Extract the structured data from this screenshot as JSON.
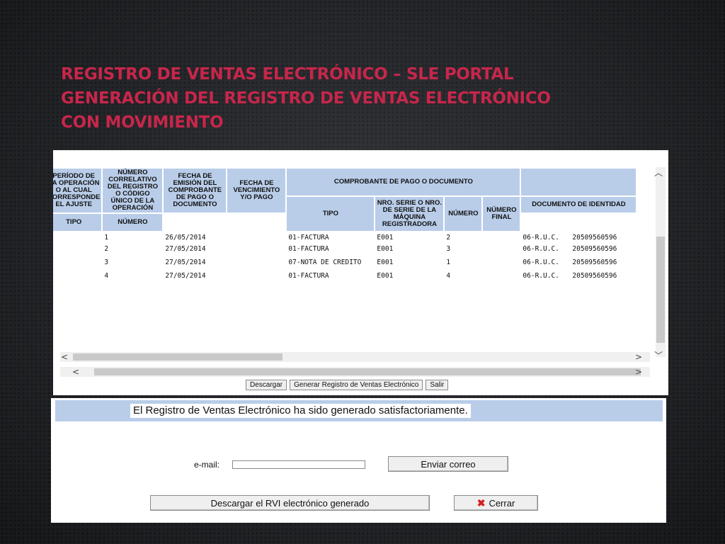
{
  "slide": {
    "title_lines": [
      "REGISTRO DE VENTAS ELECTRÓNICO – SLE PORTAL",
      "GENERACIÓN DEL REGISTRO DE VENTAS ELECTRÓNICO",
      "CON MOVIMIENTO"
    ]
  },
  "colors": {
    "title": "#c7264b",
    "header_fill": "#b9cde9",
    "cancel_icon": "#d3201f"
  },
  "table": {
    "headers": {
      "periodo": "PERÍODO DE LA OPERACIÓN O AL CUAL CORRESPONDE EL AJUSTE",
      "numero": "NÚMERO CORRELATIVO DEL REGISTRO O CÓDIGO ÚNICO DE LA OPERACIÓN",
      "fecha_emision": "FECHA DE EMISIÓN DEL COMPROBANTE DE PAGO O DOCUMENTO",
      "fecha_venc": "FECHA DE VENCIMIENTO Y/O PAGO",
      "comprobante": "COMPROBANTE DE PAGO O DOCUMENTO",
      "tipo": "TIPO",
      "serie": "NRO. SERIE O NRO. DE SERIE DE LA MÁQUINA REGISTRADORA",
      "numero_doc": "NÚMERO",
      "numero_final": "NÚMERO FINAL",
      "doc_identidad": "DOCUMENTO DE IDENTIDAD",
      "doc_tipo": "TIPO",
      "doc_numero": "NÚMERO"
    },
    "rows": [
      {
        "periodo": "",
        "num": "1",
        "fecha": "26/05/2014",
        "venc": "",
        "tipo": "01-FACTURA",
        "serie": "E001",
        "numero": "2",
        "final": "",
        "doc_tipo": "06-R.U.C.",
        "doc_num": "20509560596"
      },
      {
        "periodo": "",
        "num": "2",
        "fecha": "27/05/2014",
        "venc": "",
        "tipo": "01-FACTURA",
        "serie": "E001",
        "numero": "3",
        "final": "",
        "doc_tipo": "06-R.U.C.",
        "doc_num": "20509560596"
      },
      {
        "periodo": "",
        "num": "3",
        "fecha": "27/05/2014",
        "venc": "",
        "tipo": "07-NOTA DE CREDITO",
        "serie": "E001",
        "numero": "1",
        "final": "",
        "doc_tipo": "06-R.U.C.",
        "doc_num": "20509560596"
      },
      {
        "periodo": "",
        "num": "4",
        "fecha": "27/05/2014",
        "venc": "",
        "tipo": "01-FACTURA",
        "serie": "E001",
        "numero": "4",
        "final": "",
        "doc_tipo": "06-R.U.C.",
        "doc_num": "20509560596"
      }
    ]
  },
  "toolbar": {
    "descargar": "Descargar",
    "generar": "Generar Registro de Ventas Electrónico",
    "salir": "Salir"
  },
  "dialog": {
    "message": "El Registro de Ventas Electrónico ha sido generado satisfactoriamente.",
    "email_label": "e-mail:",
    "email_value": "",
    "send_button": "Enviar correo",
    "download_button": "Descargar el RVI electrónico generado",
    "close_button": "Cerrar"
  },
  "icons": {
    "scroll_up": "chevron-up-icon",
    "scroll_down": "chevron-down-icon",
    "scroll_left": "chevron-left-icon",
    "scroll_right": "chevron-right-icon",
    "close": "close-icon"
  }
}
